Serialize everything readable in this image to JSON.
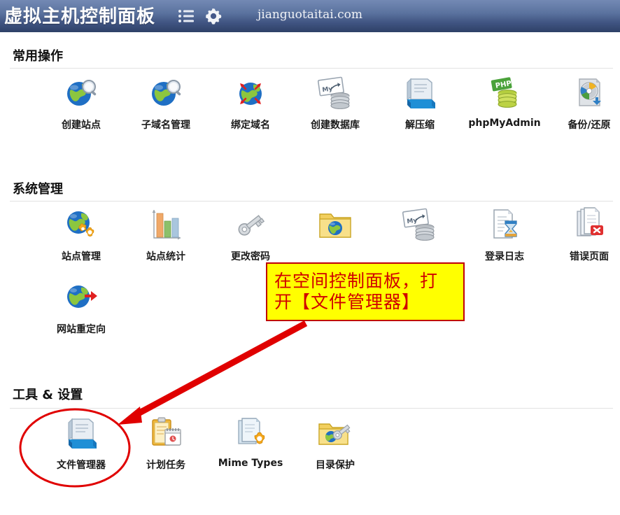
{
  "header": {
    "brand": "虚拟主机控制面板",
    "menu_icon": "list-menu-icon",
    "gear_icon": "gear-icon",
    "domain": "jianguotaitai.com",
    "gradient_top": "#7389b4",
    "gradient_bottom": "#2e4167"
  },
  "sections": [
    {
      "title": "常用操作",
      "items": [
        {
          "label": "创建站点",
          "icon": "globe-magnifier-icon"
        },
        {
          "label": "子域名管理",
          "icon": "globe-magnifier-icon"
        },
        {
          "label": "绑定域名",
          "icon": "globe-pinned-icon"
        },
        {
          "label": "创建数据库",
          "icon": "mysql-database-icon"
        },
        {
          "label": "解压缩",
          "icon": "archive-box-icon"
        },
        {
          "label": "phpMyAdmin",
          "icon": "php-database-icon"
        },
        {
          "label": "备份/还原",
          "icon": "backup-disc-icon"
        }
      ]
    },
    {
      "title": "系统管理",
      "items": [
        {
          "label": "站点管理",
          "icon": "globe-gears-icon"
        },
        {
          "label": "站点统计",
          "icon": "bar-chart-icon"
        },
        {
          "label": "更改密码",
          "icon": "key-icon",
          "occluded": true
        },
        {
          "label": "",
          "icon": "folder-globe-icon",
          "occluded": true
        },
        {
          "label": "",
          "icon": "mysql-database-icon",
          "occluded": true
        },
        {
          "label": "登录日志",
          "icon": "document-hourglass-icon"
        },
        {
          "label": "错误页面",
          "icon": "document-error-icon"
        },
        {
          "label": "网站重定向",
          "icon": "globe-arrow-icon"
        }
      ]
    },
    {
      "title": "工具 & 设置",
      "items": [
        {
          "label": "文件管理器",
          "icon": "file-manager-icon",
          "highlighted": true
        },
        {
          "label": "计划任务",
          "icon": "clipboard-calendar-icon"
        },
        {
          "label": "Mime Types",
          "icon": "document-gear-icon"
        },
        {
          "label": "目录保护",
          "icon": "folder-key-icon"
        }
      ]
    }
  ],
  "annotation": {
    "callout_line1": "在空间控制面板，打",
    "callout_line2": "开【文件管理器】",
    "callout_bg": "#ffff00",
    "callout_border": "#c00000",
    "callout_text_color": "#d00000",
    "arrow_color": "#e00000",
    "highlight_ellipse_color": "#e00000",
    "arrow_name": "red-arrow-annotation",
    "ellipse_name": "red-ellipse-highlight"
  }
}
